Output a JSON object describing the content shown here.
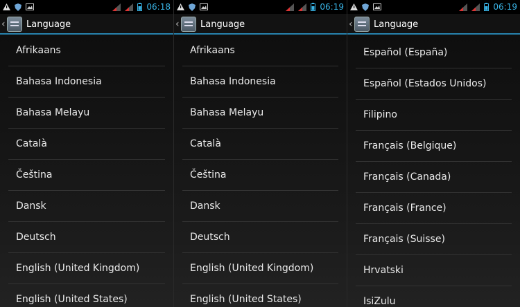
{
  "screens": [
    {
      "time": "06:18",
      "title": "Language",
      "languages": [
        "Afrikaans",
        "Bahasa Indonesia",
        "Bahasa Melayu",
        "Català",
        "Čeština",
        "Dansk",
        "Deutsch",
        "English (United Kingdom)",
        "English (United States)"
      ]
    },
    {
      "time": "06:19",
      "title": "Language",
      "languages": [
        "Afrikaans",
        "Bahasa Indonesia",
        "Bahasa Melayu",
        "Català",
        "Čeština",
        "Dansk",
        "Deutsch",
        "English (United Kingdom)",
        "English (United States)"
      ]
    },
    {
      "time": "06:19",
      "title": "Language",
      "languages": [
        "Español (España)",
        "Español (Estados Unidos)",
        "Filipino",
        "Français (Belgique)",
        "Français (Canada)",
        "Français (France)",
        "Français (Suisse)",
        "Hrvatski",
        "IsiZulu"
      ]
    }
  ],
  "status_icons": [
    "warning-icon",
    "shield-icon",
    "image-icon",
    "signal-1-icon",
    "signal-2-icon",
    "battery-icon"
  ],
  "colors": {
    "accent": "#39b4e6",
    "divider": "#333333",
    "text": "#eaeaea"
  }
}
